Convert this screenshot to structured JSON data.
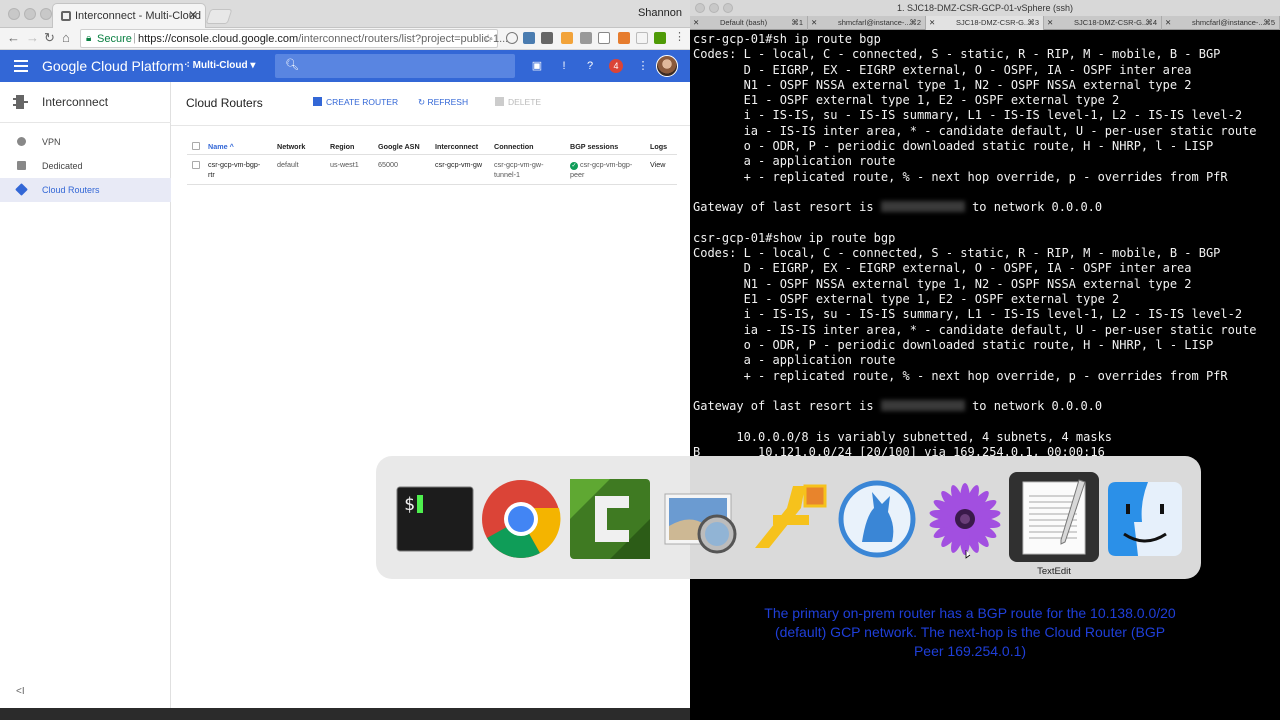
{
  "browser": {
    "tab_title": "Interconnect - Multi-Cloud",
    "profile_name": "Shannon",
    "secure_label": "Secure",
    "url_host": "https://console.cloud.google.com",
    "url_path": "/interconnect/routers/list?project=public-1...",
    "notification_count": "4"
  },
  "gcp": {
    "title": "Google Cloud Platform",
    "project": "Multi-Cloud",
    "brand_color": "#3367d6"
  },
  "sidebar": {
    "header": "Interconnect",
    "items": [
      {
        "label": "VPN",
        "icon": "vpn-icon"
      },
      {
        "label": "Dedicated",
        "icon": "dedicated-icon"
      },
      {
        "label": "Cloud Routers",
        "icon": "routers-icon",
        "active": true
      }
    ],
    "collapse_glyph": "<I"
  },
  "main": {
    "title": "Cloud Routers",
    "actions": {
      "create": "CREATE ROUTER",
      "refresh": "REFRESH",
      "delete": "DELETE"
    },
    "columns": [
      "Name ^",
      "Network",
      "Region",
      "Google ASN",
      "Interconnect",
      "Connection",
      "BGP sessions",
      "Logs"
    ],
    "rows": [
      {
        "name": "csr-gcp-vm-bgp-rtr",
        "network": "default",
        "region": "us-west1",
        "asn": "65000",
        "interconnect": "csr-gcp-vm-gw",
        "connection": "csr-gcp-vm-gw-tunnel-1",
        "bgp_sessions": "csr-gcp-vm-bgp-peer",
        "logs": "View"
      }
    ]
  },
  "terminal": {
    "window_title": "1. SJC18-DMZ-CSR-GCP-01-vSphere (ssh)",
    "tabs": [
      {
        "label": "Default (bash)",
        "shortcut": "⌘1"
      },
      {
        "label": "shmcfarl@instance-...",
        "shortcut": "⌘2"
      },
      {
        "label": "SJC18-DMZ-CSR-G...",
        "shortcut": "⌘3",
        "active": true
      },
      {
        "label": "SJC18-DMZ-CSR-G...",
        "shortcut": "⌘4"
      },
      {
        "label": "shmcfarl@instance-...",
        "shortcut": "⌘5"
      }
    ],
    "lines": [
      "csr-gcp-01#sh ip route bgp",
      "Codes: L - local, C - connected, S - static, R - RIP, M - mobile, B - BGP",
      "       D - EIGRP, EX - EIGRP external, O - OSPF, IA - OSPF inter area",
      "       N1 - OSPF NSSA external type 1, N2 - OSPF NSSA external type 2",
      "       E1 - OSPF external type 1, E2 - OSPF external type 2",
      "       i - IS-IS, su - IS-IS summary, L1 - IS-IS level-1, L2 - IS-IS level-2",
      "       ia - IS-IS inter area, * - candidate default, U - per-user static route",
      "       o - ODR, P - periodic downloaded static route, H - NHRP, l - LISP",
      "       a - application route",
      "       + - replicated route, % - next hop override, p - overrides from PfR",
      "",
      "Gateway of last resort is ",
      "",
      "csr-gcp-01#show ip route bgp",
      "Codes: L - local, C - connected, S - static, R - RIP, M - mobile, B - BGP",
      "       D - EIGRP, EX - EIGRP external, O - OSPF, IA - OSPF inter area",
      "       N1 - OSPF NSSA external type 1, N2 - OSPF NSSA external type 2",
      "       E1 - OSPF external type 1, E2 - OSPF external type 2",
      "       i - IS-IS, su - IS-IS summary, L1 - IS-IS level-1, L2 - IS-IS level-2",
      "       ia - IS-IS inter area, * - candidate default, U - per-user static route",
      "       o - ODR, P - periodic downloaded static route, H - NHRP, l - LISP",
      "       a - application route",
      "       + - replicated route, % - next hop override, p - overrides from PfR",
      "",
      "Gateway of last resort is ",
      "",
      "      10.0.0.0/8 is variably subnetted, 4 subnets, 4 masks",
      "B        10.121.0.0/24 [20/100] via 169.254.0.1, 00:00:16"
    ],
    "gateway_suffix_1": " to network 0.0.0.0",
    "gateway_suffix_2": " to network 0.0.0.0",
    "caption": "The primary on-prem router has a BGP route for the 10.138.0.0/20 (default) GCP network. The next-hop is the Cloud Router (BGP Peer 169.254.0.1)",
    "caption_color": "#1f3fd9"
  },
  "switcher": {
    "apps": [
      "terminal-icon",
      "chrome-icon",
      "camtasia-icon",
      "preview-icon",
      "keynote-icon",
      "sequel-icon",
      "purple-flower-icon",
      "textedit-icon",
      "finder-icon"
    ],
    "selected_label": "TextEdit"
  }
}
